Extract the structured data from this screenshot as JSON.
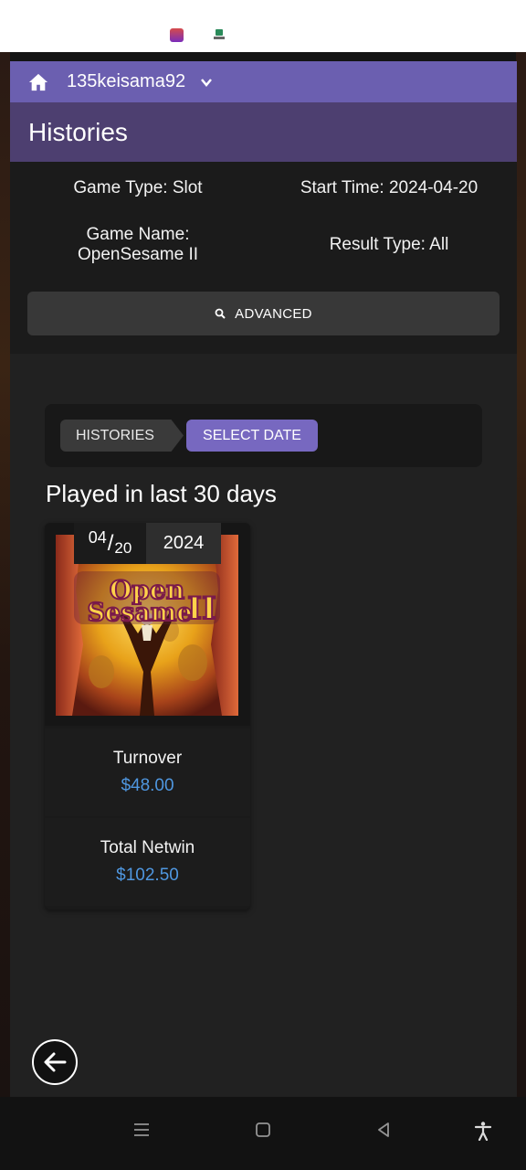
{
  "navbar": {
    "username": "135keisama92"
  },
  "page": {
    "title": "Histories"
  },
  "filters": {
    "game_type": "Game Type: Slot",
    "start_time": "Start Time: 2024-04-20",
    "game_name_line1": "Game Name:",
    "game_name_line2": "OpenSesame II",
    "result_type": "Result Type: All",
    "advanced_label": "ADVANCED"
  },
  "breadcrumb": {
    "item1": "HISTORIES",
    "item2": "SELECT DATE"
  },
  "section": {
    "title": "Played in last 30 days"
  },
  "card": {
    "month": "04",
    "slash": "/",
    "day": "20",
    "year": "2024",
    "game_logo_line1": "Open",
    "game_logo_line2": "Sesame",
    "game_logo_numeral": "II",
    "turnover_label": "Turnover",
    "turnover_value": "$48.00",
    "netwin_label": "Total Netwin",
    "netwin_value": "$102.50"
  },
  "colors": {
    "accent": "#6b5fb0",
    "title_bar": "#4d3f70",
    "value_blue": "#4f97e0",
    "breadcrumb_active": "#7768c0"
  },
  "icons": [
    "home-icon",
    "chevron-down-icon",
    "search-icon",
    "back-arrow-icon",
    "menu-icon",
    "home-square-icon",
    "back-triangle-icon",
    "accessibility-icon"
  ]
}
